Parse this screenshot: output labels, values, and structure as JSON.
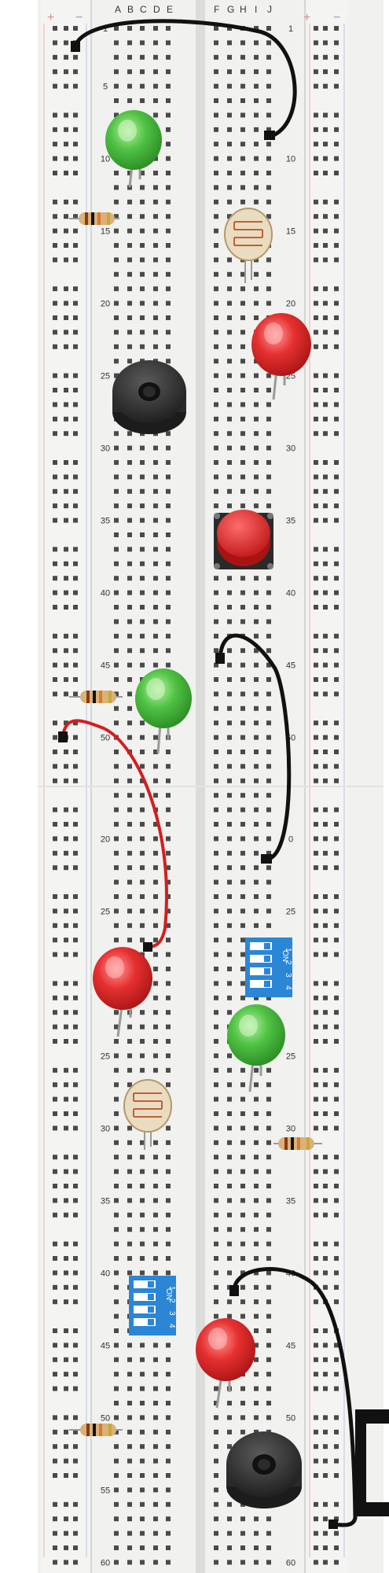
{
  "board": {
    "column_letters_left": [
      "A",
      "B",
      "C",
      "D",
      "E"
    ],
    "column_letters_right": [
      "F",
      "G",
      "H",
      "I",
      "J"
    ],
    "rail_plus": "+",
    "rail_minus": "−",
    "row_labels_left": [
      {
        "row": 1,
        "text": "1"
      },
      {
        "row": 5,
        "text": "5"
      },
      {
        "row": 10,
        "text": "10"
      },
      {
        "row": 15,
        "text": "15"
      },
      {
        "row": 20,
        "text": "20"
      },
      {
        "row": 25,
        "text": "25"
      },
      {
        "row": 30,
        "text": "30"
      },
      {
        "row": 35,
        "text": "35"
      },
      {
        "row": 40,
        "text": "40"
      },
      {
        "row": 45,
        "text": "45"
      },
      {
        "row": 50,
        "text": "50"
      },
      {
        "row": 57,
        "text": "20"
      },
      {
        "row": 62,
        "text": "25"
      },
      {
        "row": 67,
        "text": "30"
      },
      {
        "row": 72,
        "text": "25"
      },
      {
        "row": 77,
        "text": "30"
      },
      {
        "row": 82,
        "text": "35"
      },
      {
        "row": 87,
        "text": "40"
      },
      {
        "row": 92,
        "text": "45"
      },
      {
        "row": 97,
        "text": "50"
      },
      {
        "row": 102,
        "text": "55"
      },
      {
        "row": 107,
        "text": "60"
      }
    ],
    "row_labels_right": [
      {
        "row": 1,
        "text": "1"
      },
      {
        "row": 10,
        "text": "10"
      },
      {
        "row": 15,
        "text": "15"
      },
      {
        "row": 20,
        "text": "20"
      },
      {
        "row": 25,
        "text": "25"
      },
      {
        "row": 30,
        "text": "30"
      },
      {
        "row": 35,
        "text": "35"
      },
      {
        "row": 40,
        "text": "40"
      },
      {
        "row": 45,
        "text": "45"
      },
      {
        "row": 50,
        "text": "50"
      },
      {
        "row": 57,
        "text": "0"
      },
      {
        "row": 62,
        "text": "25"
      },
      {
        "row": 72,
        "text": "25"
      },
      {
        "row": 77,
        "text": "30"
      },
      {
        "row": 82,
        "text": "35"
      },
      {
        "row": 87,
        "text": "40"
      },
      {
        "row": 92,
        "text": "45"
      },
      {
        "row": 97,
        "text": "50"
      },
      {
        "row": 102,
        "text": "55"
      },
      {
        "row": 107,
        "text": "60"
      }
    ]
  },
  "dip_switch": {
    "on_label": "ON",
    "numbers": [
      "1",
      "2",
      "3",
      "4"
    ]
  },
  "components": {
    "leds": [
      {
        "color": "green",
        "hex": "#3fb23a"
      },
      {
        "color": "red",
        "hex": "#e02424"
      },
      {
        "color": "green",
        "hex": "#3fb23a"
      },
      {
        "color": "red",
        "hex": "#e02424"
      },
      {
        "color": "green",
        "hex": "#3fb23a"
      },
      {
        "color": "red",
        "hex": "#e02424"
      }
    ],
    "resistor_count": 4,
    "photoresistor_count": 2,
    "buzzer_count": 2,
    "pushbutton_count": 1,
    "dip_switch_count": 2,
    "wires": [
      {
        "color": "black",
        "hex": "#111111"
      },
      {
        "color": "black",
        "hex": "#111111"
      },
      {
        "color": "red",
        "hex": "#d41e1e"
      },
      {
        "color": "black",
        "hex": "#111111"
      }
    ]
  }
}
